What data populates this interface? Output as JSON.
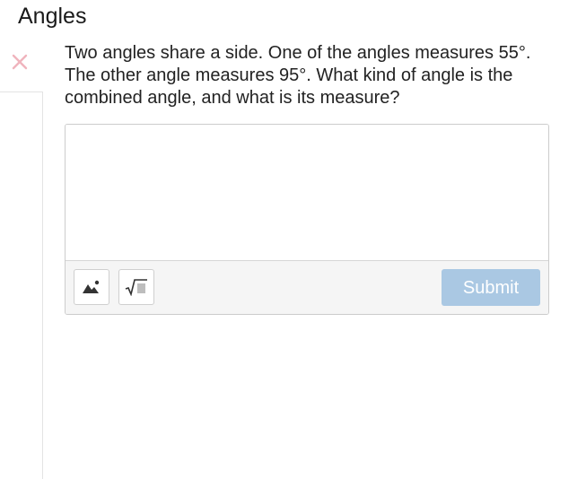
{
  "header": {
    "title": "Angles"
  },
  "question": {
    "text": "Two angles share a side. One of the angles measures 55°. The other angle measures 95°. What kind of angle is the combined angle, and what is its measure?"
  },
  "answer": {
    "value": "",
    "placeholder": ""
  },
  "toolbar": {
    "image_tool_icon": "image-icon",
    "math_tool_icon": "square-root-icon",
    "submit_label": "Submit",
    "submit_enabled": false
  },
  "icons": {
    "close": "close-icon"
  },
  "colors": {
    "close_icon": "#f0b4bd",
    "submit_disabled_bg": "#aac8e3",
    "toolbar_bg": "#f5f5f5"
  }
}
